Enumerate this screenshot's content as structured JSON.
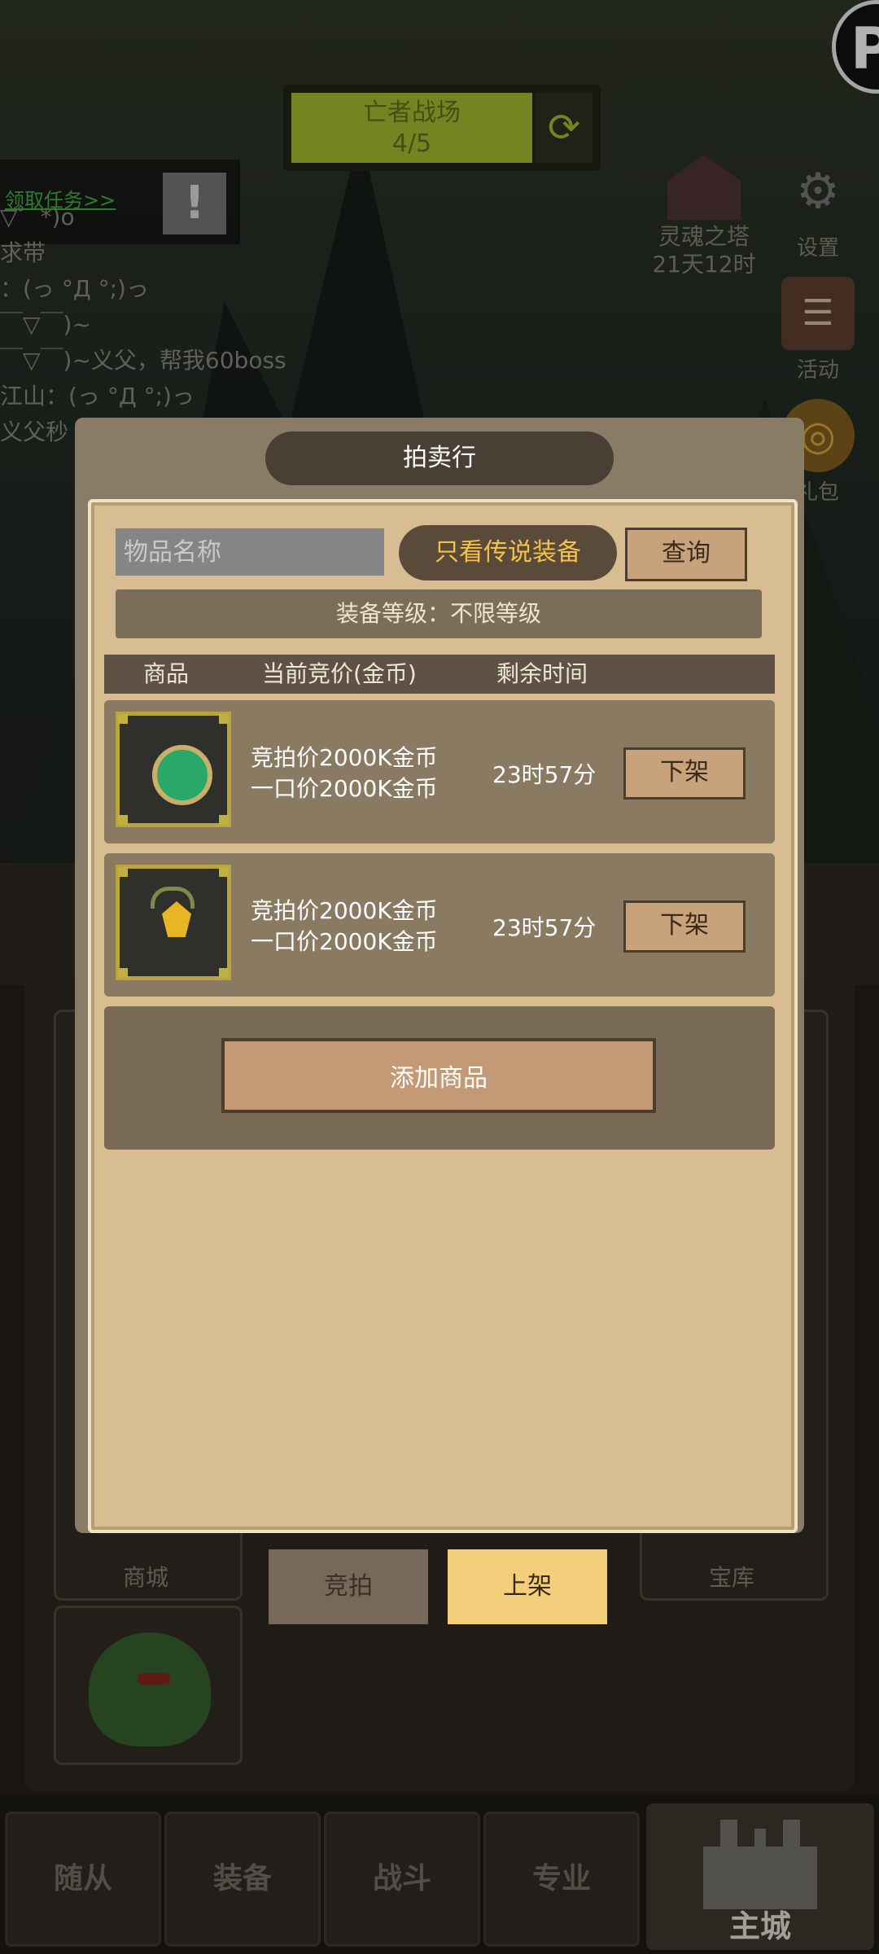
{
  "hud": {
    "battlefield_title": "亡者战场",
    "battlefield_progress": "4/5",
    "quest_label": "领取任务>>",
    "soul_tower_label": "灵魂之塔",
    "soul_tower_time": "21天12时",
    "settings_label": "设置",
    "activity_label": "活动",
    "gift_label": "礼包"
  },
  "chat_lines": [
    "▽゜*)o",
    "求带",
    "：(っ °Д °;)っ",
    "￣▽￣)~",
    "￣▽￣)~义父，帮我60boss",
    "江山：(っ °Д °;)っ",
    "义父秒"
  ],
  "background_cards": {
    "shop_label": "商城",
    "vault_label": "宝库"
  },
  "dialog": {
    "title": "拍卖行",
    "search_placeholder": "物品名称",
    "legend_only_label": "只看传说装备",
    "query_button": "查询",
    "level_filter": "装备等级：不限等级",
    "columns": [
      "商品",
      "当前竞价(金币)",
      "剩余时间"
    ],
    "rows": [
      {
        "bid": "竞拍价2000K金币",
        "buyout": "一口价2000K金币",
        "remaining": "23时57分",
        "action": "下架",
        "item_icon": "emerald-amulet-icon"
      },
      {
        "bid": "竞拍价2000K金币",
        "buyout": "一口价2000K金币",
        "remaining": "23时57分",
        "action": "下架",
        "item_icon": "gold-charm-icon"
      }
    ],
    "add_item_button": "添加商品"
  },
  "tabs": {
    "auction": "竞拍",
    "list": "上架"
  },
  "bottom_nav": {
    "followers": "随从",
    "equipment": "装备",
    "battle": "战斗",
    "profession": "专业",
    "main_city": "主城"
  },
  "colors": {
    "legend_gold": "#f2c24a",
    "selected_tab": "#f4cf7b",
    "item_frame": "#b9a53b"
  }
}
